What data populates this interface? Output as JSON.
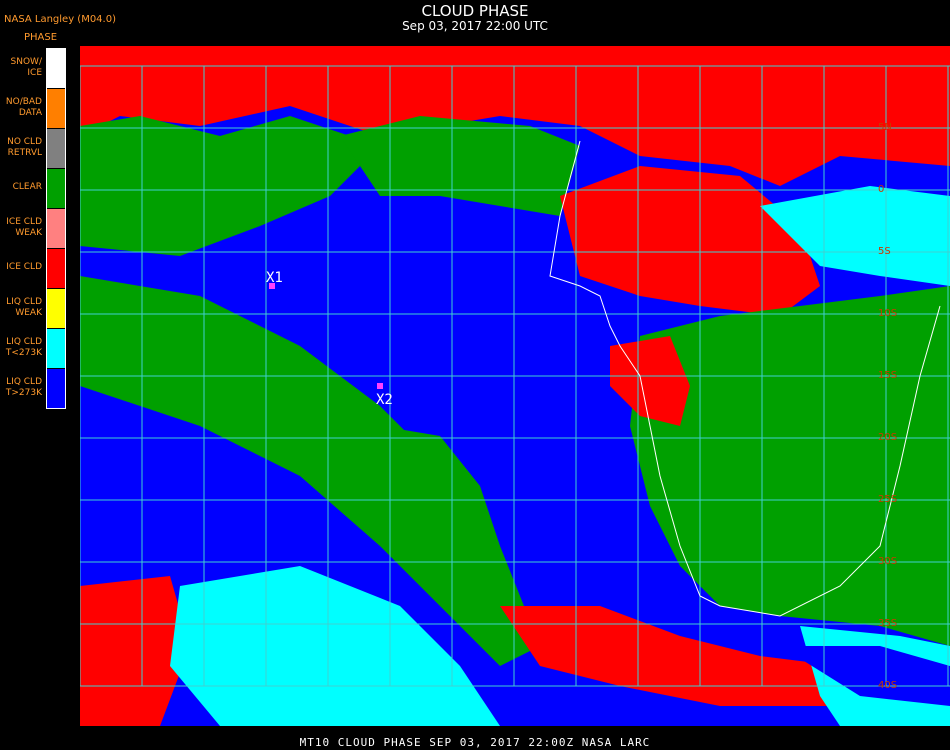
{
  "header": {
    "source": "NASA Langley (M04.0)",
    "legend_title": "PHASE",
    "title": "CLOUD PHASE",
    "subtitle": "Sep 03, 2017 22:00 UTC"
  },
  "legend": [
    {
      "label": "SNOW/\nICE",
      "color": "#ffffff"
    },
    {
      "label": "NO/BAD\nDATA",
      "color": "#ff7f00"
    },
    {
      "label": "NO CLD\nRETRVL",
      "color": "#808080"
    },
    {
      "label": "CLEAR",
      "color": "#00a000"
    },
    {
      "label": "ICE CLD\nWEAK",
      "color": "#ff8080"
    },
    {
      "label": "ICE CLD",
      "color": "#ff0000"
    },
    {
      "label": "LIQ CLD\nWEAK",
      "color": "#ffff00"
    },
    {
      "label": "LIQ CLD\nT<273K",
      "color": "#00ffff"
    },
    {
      "label": "LIQ CLD\nT>273K",
      "color": "#0000ff"
    }
  ],
  "markers": [
    {
      "label": "X1",
      "color": "#ff40ff"
    },
    {
      "label": "X2",
      "color": "#ff40ff"
    }
  ],
  "lat_labels": [
    "5N",
    "0",
    "5S",
    "10S",
    "15S",
    "20S",
    "25S",
    "30S",
    "35S",
    "40S"
  ],
  "footer": "MT10  CLOUD PHASE   SEP 03, 2017 22:00Z   NASA LARC"
}
